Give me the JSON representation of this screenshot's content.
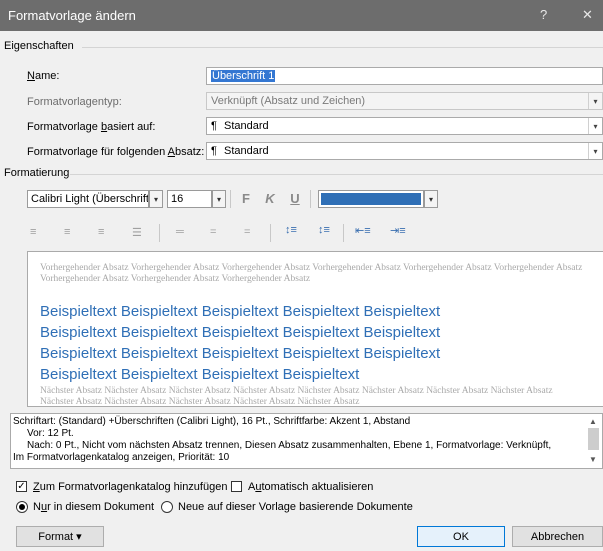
{
  "window": {
    "title": "Formatvorlage ändern",
    "help": "?",
    "close": "✕"
  },
  "properties": {
    "group_label": "Eigenschaften",
    "name_label": "Name:",
    "name_value": "Überschrift 1",
    "type_label": "Formatvorlagentyp:",
    "type_value": "Verknüpft (Absatz und Zeichen)",
    "based_label": "Formatvorlage basiert auf:",
    "based_value": "Standard",
    "next_label": "Formatvorlage für folgenden Absatz:",
    "next_value": "Standard",
    "para_mark": "¶"
  },
  "formatting": {
    "group_label": "Formatierung",
    "font": "Calibri Light (Überschriften)",
    "size": "16",
    "bold": "F",
    "italic": "K",
    "underline": "U",
    "color": "#2f6fb6"
  },
  "preview": {
    "prev_text": "Vorhergehender Absatz Vorhergehender Absatz Vorhergehender Absatz Vorhergehender Absatz Vorhergehender Absatz Vorhergehender Absatz Vorhergehender Absatz Vorhergehender Absatz Vorhergehender Absatz",
    "sample_lines": [
      "Beispieltext Beispieltext Beispieltext Beispieltext Beispieltext",
      "Beispieltext Beispieltext Beispieltext Beispieltext Beispieltext",
      "Beispieltext Beispieltext Beispieltext Beispieltext Beispieltext",
      "Beispieltext Beispieltext Beispieltext Beispieltext"
    ],
    "next_text": "Nächster Absatz Nächster Absatz Nächster Absatz Nächster Absatz Nächster Absatz Nächster Absatz Nächster Absatz Nächster Absatz Nächster Absatz Nächster Absatz Nächster Absatz Nächster Absatz Nächster Absatz"
  },
  "description": {
    "line1": "Schriftart: (Standard) +Überschriften (Calibri Light), 16 Pt., Schriftfarbe: Akzent 1, Abstand",
    "line2": "Vor:  12 Pt.",
    "line3": "Nach:  0 Pt., Nicht vom nächsten Absatz trennen, Diesen Absatz zusammenhalten, Ebene 1, Formatvorlage: Verknüpft,",
    "line4": "Im Formatvorlagenkatalog anzeigen, Priorität: 10"
  },
  "options": {
    "add_gallery": "Zum Formatvorlagenkatalog hinzufügen",
    "add_gallery_checked": true,
    "auto_update": "Automatisch aktualisieren",
    "auto_update_checked": false,
    "only_doc": "Nur in diesem Dokument",
    "new_docs": "Neue auf dieser Vorlage basierende Dokumente"
  },
  "buttons": {
    "format": "Format ▾",
    "ok": "OK",
    "cancel": "Abbrechen"
  }
}
